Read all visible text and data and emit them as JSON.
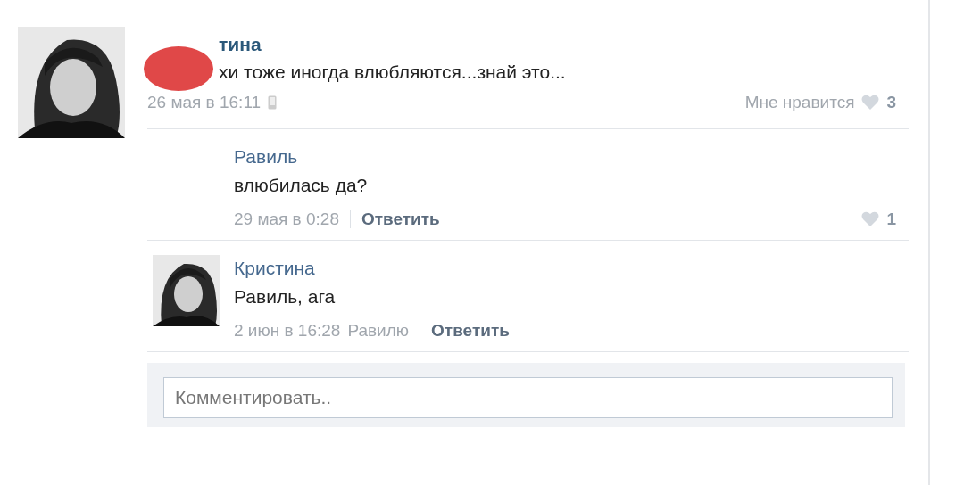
{
  "post": {
    "author": "тина",
    "text": "хи тоже иногда влюбляются...знай это...",
    "date": "26 мая в 16:11",
    "like_label": "Мне нравится",
    "likes": "3",
    "redacted": true
  },
  "replies": [
    {
      "author": "Равиль",
      "text": "влюбилась да?",
      "date": "29 мая в 0:28",
      "reply_action": "Ответить",
      "likes": "1"
    },
    {
      "author": "Кристина",
      "text": "Равиль, ага",
      "date": "2 июн в 16:28",
      "addressee": "Равилю",
      "reply_action": "Ответить"
    }
  ],
  "comment_field": {
    "placeholder": "Комментировать.."
  }
}
